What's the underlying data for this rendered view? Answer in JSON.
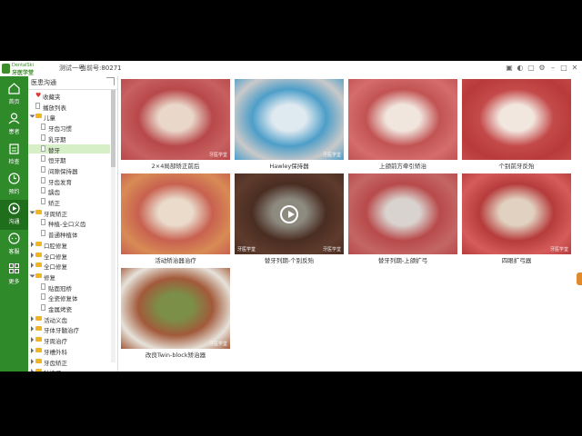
{
  "app": {
    "logo_line1": "DentalSki",
    "logo_line2": "牙医学堂",
    "tabs": [
      "测试一号",
      "当前号:80271"
    ],
    "window_controls": [
      "image-icon",
      "skin-icon",
      "lock-icon",
      "settings-icon",
      "minimize-icon",
      "maximize-icon",
      "close-icon"
    ]
  },
  "sidebar": {
    "items": [
      {
        "label": "首页",
        "icon": "home-icon"
      },
      {
        "label": "患者",
        "icon": "person-icon"
      },
      {
        "label": "检查",
        "icon": "clipboard-icon"
      },
      {
        "label": "预约",
        "icon": "calendar-icon"
      },
      {
        "label": "沟通",
        "icon": "play-icon",
        "active": true
      },
      {
        "label": "客服",
        "icon": "chat-icon"
      },
      {
        "label": "更多",
        "icon": "grid-icon"
      }
    ]
  },
  "tree": {
    "title": "医患沟通",
    "rows": [
      {
        "label": "收藏夹",
        "type": "heart",
        "level": 1
      },
      {
        "label": "播放列表",
        "type": "doc",
        "level": 1
      },
      {
        "label": "儿童",
        "type": "folder-open",
        "level": 0
      },
      {
        "label": "牙齿习惯",
        "type": "doc",
        "level": 2
      },
      {
        "label": "乳牙期",
        "type": "doc",
        "level": 2
      },
      {
        "label": "替牙",
        "type": "doc",
        "level": 2,
        "selected": true
      },
      {
        "label": "恒牙期",
        "type": "doc",
        "level": 2
      },
      {
        "label": "间隙保持器",
        "type": "doc",
        "level": 2
      },
      {
        "label": "牙齿发育",
        "type": "doc",
        "level": 2
      },
      {
        "label": "龋齿",
        "type": "doc",
        "level": 2
      },
      {
        "label": "矫正",
        "type": "doc",
        "level": 2
      },
      {
        "label": "牙周矫正",
        "type": "folder-open",
        "level": 0
      },
      {
        "label": "种植-全口义齿",
        "type": "doc",
        "level": 2
      },
      {
        "label": "普通种植体",
        "type": "doc",
        "level": 2
      },
      {
        "label": "口腔修复",
        "type": "folder",
        "level": 0
      },
      {
        "label": "全口修复",
        "type": "folder",
        "level": 0
      },
      {
        "label": "全口修复",
        "type": "folder",
        "level": 0
      },
      {
        "label": "修复",
        "type": "folder-open",
        "level": 0
      },
      {
        "label": "贴面冠桥",
        "type": "doc",
        "level": 2
      },
      {
        "label": "全瓷修复体",
        "type": "doc",
        "level": 2
      },
      {
        "label": "金属烤瓷",
        "type": "doc",
        "level": 2
      },
      {
        "label": "活动义齿",
        "type": "folder",
        "level": 0
      },
      {
        "label": "牙体牙髓治疗",
        "type": "folder",
        "level": 0
      },
      {
        "label": "牙周治疗",
        "type": "folder",
        "level": 0
      },
      {
        "label": "牙槽外科",
        "type": "folder",
        "level": 0
      },
      {
        "label": "牙齿矫正",
        "type": "folder",
        "level": 0
      },
      {
        "label": "种植牙",
        "type": "folder",
        "level": 0
      }
    ]
  },
  "gallery": {
    "items": [
      {
        "caption": "2×4局部矫正前后",
        "kind": "photo",
        "palette": [
          "#b8484a",
          "#e9d7c9",
          "#c76060"
        ],
        "watermark": "牙医学堂"
      },
      {
        "caption": "Hawley保持器",
        "kind": "photo",
        "palette": [
          "#4d9ec9",
          "#dfe9f0",
          "#c9c9c9"
        ],
        "watermark": "牙医学堂"
      },
      {
        "caption": "上颌前方牵引矫治",
        "kind": "photo",
        "palette": [
          "#c25353",
          "#f1e6de",
          "#d56d6d"
        ],
        "watermark": ""
      },
      {
        "caption": "个别前牙反殆",
        "kind": "photo",
        "palette": [
          "#c44a4a",
          "#f2e7df",
          "#b93a3a"
        ],
        "watermark": ""
      },
      {
        "caption": "活动矫治器治疗",
        "kind": "photo",
        "palette": [
          "#c86150",
          "#eadbcb",
          "#d88b55"
        ],
        "watermark": ""
      },
      {
        "caption": "替牙列期-个别反殆",
        "kind": "video",
        "palette": [
          "#4a2d22",
          "#8d8a80",
          "#5e3b2c"
        ],
        "badge": "牙医学堂",
        "watermark": "牙医学堂"
      },
      {
        "caption": "替牙列期-上颌扩弓",
        "kind": "photo",
        "palette": [
          "#b84a4a",
          "#d9d3cf",
          "#c46666"
        ],
        "watermark": ""
      },
      {
        "caption": "四眼扩弓器",
        "kind": "photo",
        "palette": [
          "#b63c3c",
          "#e1d1c0",
          "#d65b5b"
        ],
        "watermark": "牙医学堂"
      },
      {
        "caption": "改良Twin-block矫治器",
        "kind": "photo",
        "palette": [
          "#a25a3a",
          "#7b8f48",
          "#e6e2da"
        ],
        "watermark": "牙医学堂"
      }
    ]
  }
}
